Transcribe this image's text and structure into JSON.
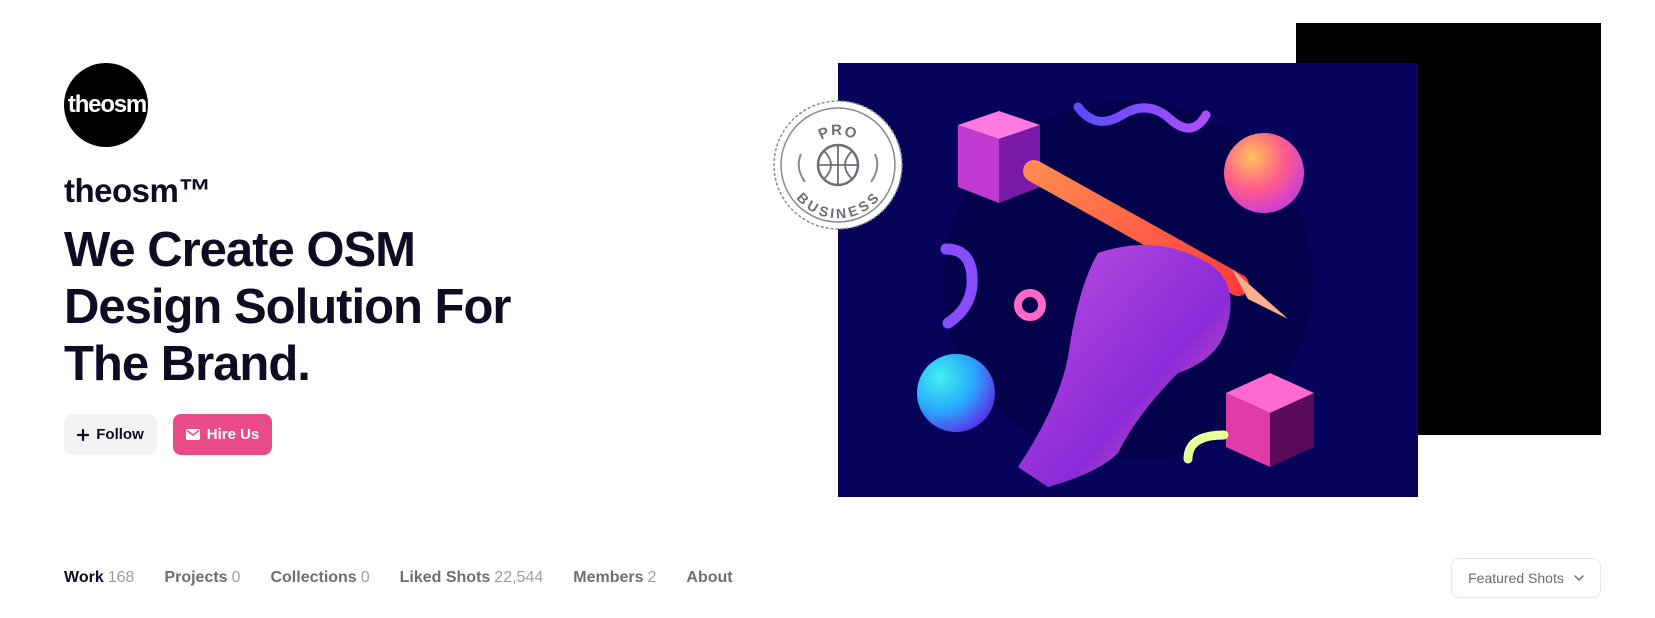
{
  "profile": {
    "avatar_text": "theosm",
    "name": "theosm™",
    "headline": "We Create OSM Design Solution For The Brand."
  },
  "actions": {
    "follow_label": "Follow",
    "hire_label": "Hire Us",
    "hire_color": "#ea4c89"
  },
  "badge": {
    "top_text": "PRO",
    "bottom_text": "BUSINESS"
  },
  "tabs": [
    {
      "label": "Work",
      "count": "168",
      "active": true
    },
    {
      "label": "Projects",
      "count": "0"
    },
    {
      "label": "Collections",
      "count": "0"
    },
    {
      "label": "Liked Shots",
      "count": "22,544"
    },
    {
      "label": "Members",
      "count": "2"
    },
    {
      "label": "About",
      "count": ""
    }
  ],
  "filter": {
    "label": "Featured Shots",
    "icon": "chevron-down-icon"
  },
  "colors": {
    "text_dark": "#0d0c22",
    "shot_background": "#06045a"
  }
}
